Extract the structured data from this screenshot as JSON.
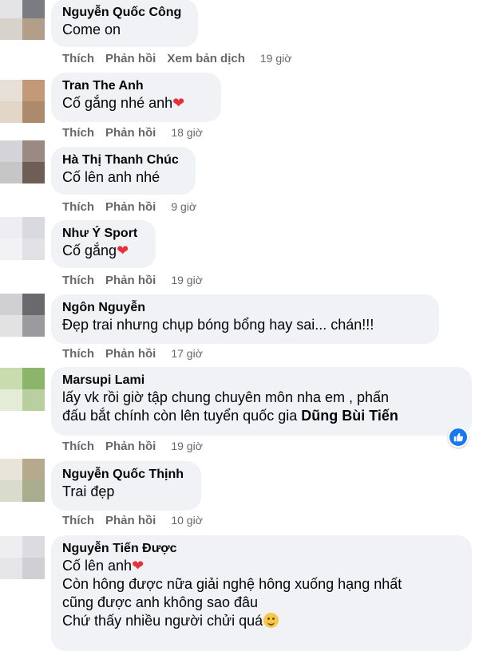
{
  "comments": [
    {
      "name": "Nguyễn Quốc Công",
      "lines": [
        "Come on"
      ],
      "actions": {
        "like": "Thích",
        "reply": "Phản hồi",
        "translate": "Xem bản dịch"
      },
      "time": "19 giờ"
    },
    {
      "name": "Tran The Anh",
      "lines": [
        "Cố gắng nhé anh"
      ],
      "actions": {
        "like": "Thích",
        "reply": "Phản hồi"
      },
      "time": "18 giờ"
    },
    {
      "name": "Hà Thị Thanh Chúc",
      "lines": [
        "Cố lên anh nhé"
      ],
      "actions": {
        "like": "Thích",
        "reply": "Phản hồi"
      },
      "time": "9 giờ"
    },
    {
      "name": "Như Ý Sport",
      "lines": [
        "Cố gắng"
      ],
      "actions": {
        "like": "Thích",
        "reply": "Phản hồi"
      },
      "time": "19 giờ"
    },
    {
      "name": "Ngôn Nguyễn",
      "lines": [
        "Đẹp trai nhưng chụp bóng bổng hay sai... chán!!!"
      ],
      "actions": {
        "like": "Thích",
        "reply": "Phản hồi"
      },
      "time": "17 giờ"
    },
    {
      "name": "Marsupi Lami",
      "lines": [
        "lấy vk rồi giờ tập chung chuyên môn nha em , phấn",
        "đấu bắt chính còn lên tuyển quốc gia "
      ],
      "mention": "Dũng Bùi Tiến",
      "actions": {
        "like": "Thích",
        "reply": "Phản hồi"
      },
      "time": "19 giờ",
      "reaction": "like-icon"
    },
    {
      "name": "Nguyễn Quốc Thịnh",
      "lines": [
        "Trai đẹp"
      ],
      "actions": {
        "like": "Thích",
        "reply": "Phản hồi"
      },
      "time": "10 giờ"
    },
    {
      "name": "Nguyễn Tiến Được",
      "lines": [
        "Cố lên anh",
        "Còn hông được nữa giải nghệ hông xuống hạng nhất",
        "cũng được anh không sao đâu",
        "Chứ thấy nhiều người chửi quá"
      ]
    }
  ],
  "colors": {
    "bubble": "#f0f2f5",
    "meta": "#65676b",
    "heart": "#e8303a",
    "like": "#1877f2"
  }
}
